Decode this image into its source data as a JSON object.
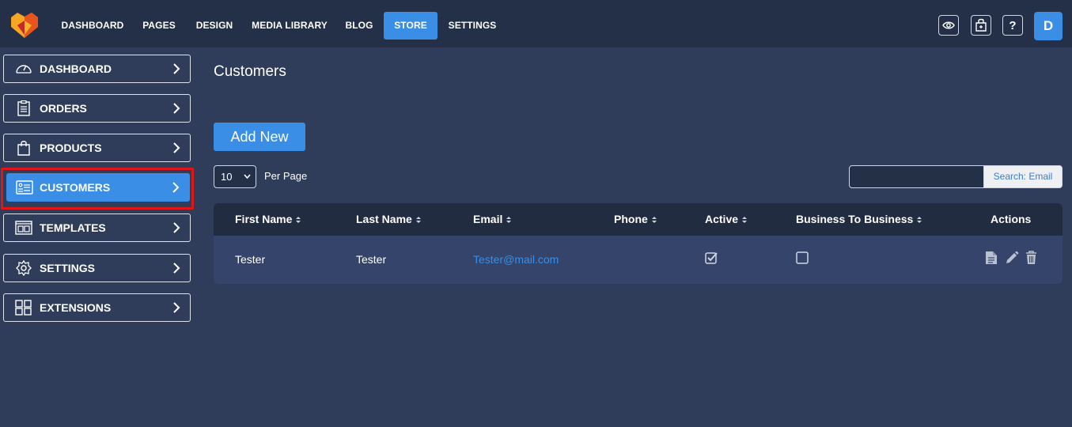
{
  "topnav": {
    "items": [
      "DASHBOARD",
      "PAGES",
      "DESIGN",
      "MEDIA LIBRARY",
      "BLOG",
      "STORE",
      "SETTINGS"
    ],
    "active": "STORE",
    "icons": [
      "eye-icon",
      "store-bag-icon",
      "help-icon"
    ],
    "help_glyph": "?",
    "avatar_letter": "D"
  },
  "sidebar": {
    "items": [
      {
        "label": "DASHBOARD",
        "icon": "speedometer-icon"
      },
      {
        "label": "ORDERS",
        "icon": "clipboard-icon"
      },
      {
        "label": "PRODUCTS",
        "icon": "shopping-bag-icon"
      },
      {
        "label": "CUSTOMERS",
        "icon": "contact-card-icon"
      },
      {
        "label": "TEMPLATES",
        "icon": "template-icon"
      },
      {
        "label": "SETTINGS",
        "icon": "gear-icon"
      },
      {
        "label": "EXTENSIONS",
        "icon": "grid-icon"
      }
    ],
    "active": "CUSTOMERS"
  },
  "main": {
    "title": "Customers",
    "add_button": "Add New",
    "per_page_value": "10",
    "per_page_label": "Per Page",
    "search_value": "",
    "search_button": "Search: Email"
  },
  "table": {
    "columns": [
      "First Name",
      "Last Name",
      "Email",
      "Phone",
      "Active",
      "Business To Business",
      "Actions"
    ],
    "rows": [
      {
        "first_name": "Tester",
        "last_name": "Tester",
        "email": "Tester@mail.com",
        "phone": "",
        "active": true,
        "b2b": false
      }
    ],
    "actions": [
      "document-icon",
      "pencil-icon",
      "trash-icon"
    ]
  },
  "colors": {
    "background": "#2f3d5b",
    "topbar": "#243047",
    "accent": "#3a8ee6",
    "highlight": "#e01616"
  }
}
